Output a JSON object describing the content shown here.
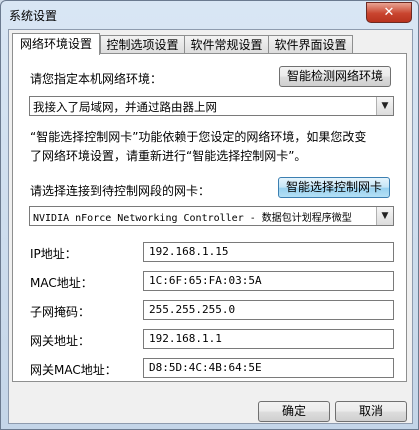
{
  "window": {
    "title": "系统设置",
    "close_glyph": "✕"
  },
  "tabs": [
    {
      "label": "网络环境设置",
      "active": true
    },
    {
      "label": "控制选项设置",
      "active": false
    },
    {
      "label": "软件常规设置",
      "active": false
    },
    {
      "label": "软件界面设置",
      "active": false
    }
  ],
  "network": {
    "env_label": "请您指定本机网络环境：",
    "detect_button": "智能检测网络环境",
    "env_selected": "我接入了局域网，并通过路由器上网",
    "note_line1": "“智能选择控制网卡”功能依赖于您设定的网络环境，如果您改变",
    "note_line2": "了网络环境设置，请重新进行“智能选择控制网卡”。",
    "nic_label": "请选择连接到待控制网段的网卡：",
    "nic_button": "智能选择控制网卡",
    "nic_selected": "NVIDIA nForce Networking Controller - 数据包计划程序微型"
  },
  "fields": [
    {
      "label": "IP地址：",
      "value": "192.168.1.15"
    },
    {
      "label": "MAC地址：",
      "value": "1C:6F:65:FA:03:5A"
    },
    {
      "label": "子网掩码：",
      "value": "255.255.255.0"
    },
    {
      "label": "网关地址：",
      "value": "192.168.1.1"
    },
    {
      "label": "网关MAC地址：",
      "value": "D8:5D:4C:4B:64:5E"
    }
  ],
  "footer": {
    "ok": "确定",
    "cancel": "取消"
  },
  "icons": {
    "dropdown": "▼"
  }
}
